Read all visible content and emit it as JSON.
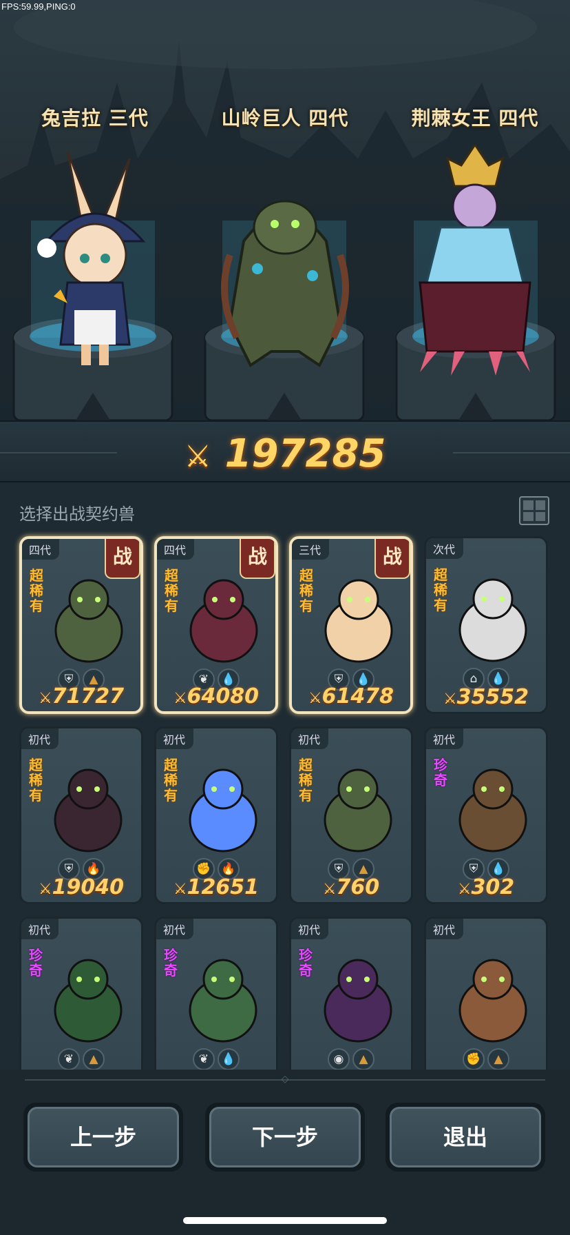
{
  "status": {
    "fps_text": "FPS:59.99,PING:0"
  },
  "showcase": [
    {
      "name": "兔吉拉 三代"
    },
    {
      "name": "山岭巨人 四代"
    },
    {
      "name": "荆棘女王 四代"
    }
  ],
  "total_power": "197285",
  "list_title": "选择出战契约兽",
  "cards": [
    {
      "gen": "四代",
      "rarity": "超稀有",
      "battle": "战",
      "selected": true,
      "power": "71727",
      "beast": "mountain-giant",
      "tags": [
        "shield-icon",
        "rock-icon"
      ]
    },
    {
      "gen": "四代",
      "rarity": "超稀有",
      "battle": "战",
      "selected": true,
      "power": "64080",
      "beast": "thorn-queen",
      "tags": [
        "leaf-icon",
        "water-icon"
      ]
    },
    {
      "gen": "三代",
      "rarity": "超稀有",
      "battle": "战",
      "selected": true,
      "power": "61478",
      "beast": "bunny-mage",
      "tags": [
        "shield-icon",
        "water-icon"
      ]
    },
    {
      "gen": "次代",
      "rarity": "超稀有",
      "battle": "",
      "selected": false,
      "power": "35552",
      "beast": "white-dragon",
      "tags": [
        "temple-icon",
        "water-icon"
      ]
    },
    {
      "gen": "初代",
      "rarity": "超稀有",
      "battle": "",
      "selected": false,
      "power": "19040",
      "beast": "dark-wolf",
      "tags": [
        "shield-icon",
        "fire-icon"
      ]
    },
    {
      "gen": "初代",
      "rarity": "超稀有",
      "battle": "",
      "selected": false,
      "power": "12651",
      "beast": "blue-spirit",
      "tags": [
        "fist-icon",
        "fire-icon"
      ]
    },
    {
      "gen": "初代",
      "rarity": "超稀有",
      "battle": "",
      "selected": false,
      "power": "760",
      "beast": "mountain-giant",
      "tags": [
        "shield-icon",
        "rock-icon"
      ]
    },
    {
      "gen": "初代",
      "rarity": "珍奇",
      "battle": "",
      "selected": false,
      "power": "302",
      "beast": "tree-kid",
      "tags": [
        "shield-icon",
        "water-icon"
      ]
    },
    {
      "gen": "初代",
      "rarity": "珍奇",
      "battle": "",
      "selected": false,
      "power": "",
      "beast": "moss-golem",
      "tags": [
        "leaf-icon",
        "rock-icon"
      ]
    },
    {
      "gen": "初代",
      "rarity": "珍奇",
      "battle": "",
      "selected": false,
      "power": "",
      "beast": "sprout-bug",
      "tags": [
        "leaf-icon",
        "water-icon"
      ]
    },
    {
      "gen": "初代",
      "rarity": "珍奇",
      "battle": "",
      "selected": false,
      "power": "",
      "beast": "shadow-imp",
      "tags": [
        "eye-icon",
        "rock-icon"
      ]
    },
    {
      "gen": "初代",
      "rarity": "",
      "battle": "",
      "selected": false,
      "power": "",
      "beast": "lion-beast",
      "tags": [
        "fist-icon",
        "rock-icon"
      ]
    }
  ],
  "buttons": {
    "prev": "上一步",
    "next": "下一步",
    "exit": "退出"
  },
  "colors": {
    "gold": "#ffd566",
    "ssr": "#ffbc32",
    "epic": "#e64bff",
    "panel": "#33454f"
  }
}
